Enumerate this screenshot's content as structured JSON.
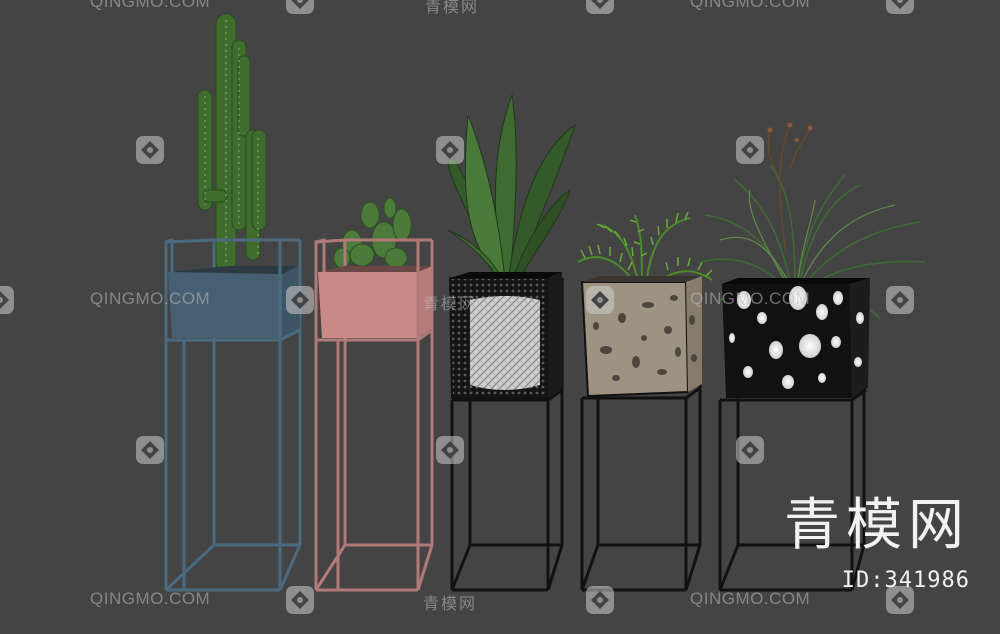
{
  "image": {
    "background_color": "#444444",
    "subject": "five plant stands with potted plants",
    "watermark": {
      "site_latin": "QINGMO.COM",
      "site_chinese": "青模网"
    },
    "brand_mark": "青模网",
    "model_id": "ID:341986",
    "stands": [
      {
        "name": "blue-stand",
        "frame_color": "#4a6a80",
        "pot_color": "#3e5566",
        "plant": "cactus-icon"
      },
      {
        "name": "pink-stand",
        "frame_color": "#b07a78",
        "pot_color": "#c98a86",
        "plant": "succulent-icon"
      },
      {
        "name": "mesh-stand",
        "frame_color": "#111111",
        "pot_color": "#151515",
        "plant": "agave-icon"
      },
      {
        "name": "terrazzo-stand",
        "frame_color": "#111111",
        "pot_color": "#9e9282",
        "plant": "fern-icon"
      },
      {
        "name": "spotted-stand",
        "frame_color": "#111111",
        "pot_color": "#111111",
        "plant": "grass-icon"
      }
    ]
  }
}
